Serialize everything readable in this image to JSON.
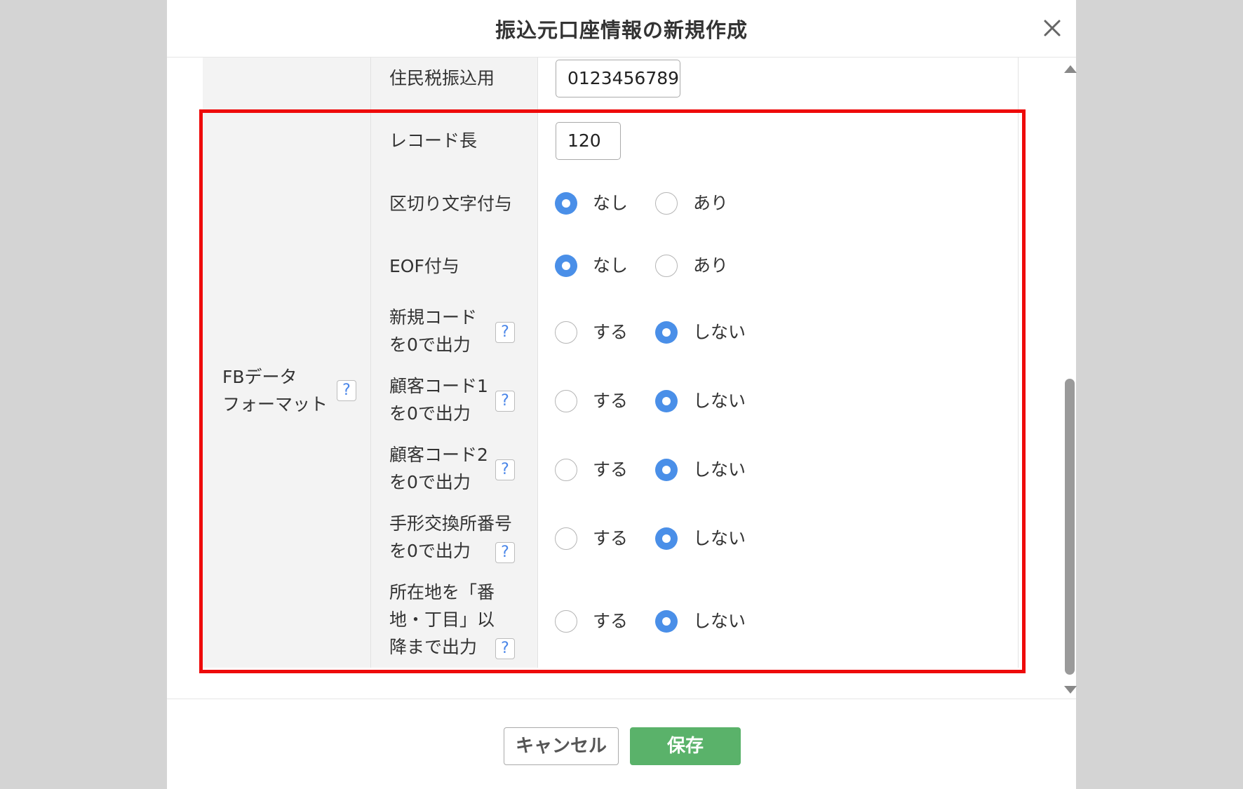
{
  "dialog": {
    "title": "振込元口座情報の新規作成",
    "close_icon": "close-icon"
  },
  "resident_tax": {
    "label": "住民税振込用",
    "value": "0123456789"
  },
  "fb_format": {
    "group_label_line1": "FBデータ",
    "group_label_line2": "フォーマット",
    "help_text": "?",
    "record_length": {
      "label": "レコード長",
      "value": "120"
    },
    "delimiter": {
      "label": "区切り文字付与",
      "options": [
        "なし",
        "あり"
      ],
      "selected": "なし"
    },
    "eof": {
      "label": "EOF付与",
      "options": [
        "なし",
        "あり"
      ],
      "selected": "なし"
    },
    "new_code_zero": {
      "label_line1": "新規コード",
      "label_line2": "を0で出力",
      "options": [
        "する",
        "しない"
      ],
      "selected": "しない"
    },
    "customer_code1_zero": {
      "label_line1": "顧客コード1",
      "label_line2": "を0で出力",
      "options": [
        "する",
        "しない"
      ],
      "selected": "しない"
    },
    "customer_code2_zero": {
      "label_line1": "顧客コード2",
      "label_line2": "を0で出力",
      "options": [
        "する",
        "しない"
      ],
      "selected": "しない"
    },
    "clearing_house_zero": {
      "label_line1": "手形交換所番号",
      "label_line2": "を0で出力",
      "options": [
        "する",
        "しない"
      ],
      "selected": "しない"
    },
    "address_full": {
      "label_line1": "所在地を「番",
      "label_line2": "地・丁目」以",
      "label_line3": "降まで出力",
      "options": [
        "する",
        "しない"
      ],
      "selected": "しない"
    }
  },
  "footer": {
    "cancel_label": "キャンセル",
    "save_label": "保存"
  },
  "colors": {
    "accent": "#4a8fe8",
    "save_button": "#5ab26a",
    "highlight": "#ee0a0a",
    "label_background": "#f3f3f3"
  }
}
